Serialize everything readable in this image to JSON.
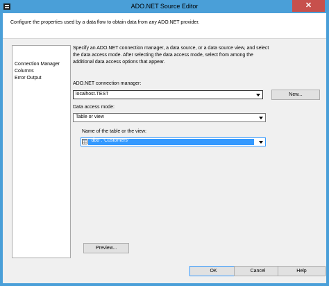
{
  "window": {
    "title": "ADO.NET Source Editor",
    "close_glyph": "✕"
  },
  "header": {
    "description": "Configure the properties used by a data flow to obtain data from any ADO.NET provider."
  },
  "nav": {
    "items": [
      {
        "label": "Connection Manager"
      },
      {
        "label": "Columns"
      },
      {
        "label": "Error Output"
      }
    ]
  },
  "main": {
    "instructions": "Specify an ADO.NET connection manager, a data source, or a data source view, and select the data access mode. After selecting the data access mode, select from among the additional data access options that appear.",
    "connection_label": "ADO.NET connection manager:",
    "connection_value": "localhost.TEST",
    "new_button": "New...",
    "access_mode_label": "Data access mode:",
    "access_mode_value": "Table or view",
    "table_label": "Name of the table or the view:",
    "table_value": "\"dbo\".\"Customers\"",
    "preview_button": "Preview..."
  },
  "footer": {
    "ok": "OK",
    "cancel": "Cancel",
    "help": "Help"
  },
  "colors": {
    "titlebar": "#4a9fd8",
    "close": "#c7504c",
    "selection": "#3399ff"
  },
  "icons": [
    "app-icon",
    "close-icon",
    "dropdown-arrow-icon",
    "table-icon"
  ]
}
